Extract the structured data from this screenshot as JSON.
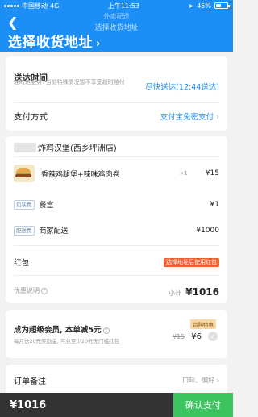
{
  "status_bar": {
    "carrier": "中国移动",
    "network": "4G",
    "time": "上午11:53",
    "battery": "45%",
    "battery_level": 0.45
  },
  "header": {
    "back_icon": "chevron-left-icon",
    "faded_tab": "外卖配送",
    "faded_title": "选择收货地址",
    "title": "选择收货地址",
    "title_arrow": "›"
  },
  "delivery_card": {
    "delivery_label": "送达时间",
    "delivery_note": "准时达服务: 当前特殊情况暂不享受超时赔付",
    "delivery_value": "尽快送达(12:44送达)",
    "payment_label": "支付方式",
    "payment_value": "支付宝免密支付",
    "arrow": "›"
  },
  "order_card": {
    "shop_name": "炸鸡汉堡(西乡坪洲店)",
    "item": {
      "name": "香辣鸡腿堡+辣味鸡肉卷",
      "qty": "×1",
      "price": "¥15"
    },
    "packing": {
      "tag": "包装费",
      "label": "餐盒",
      "price": "¥1"
    },
    "delivery": {
      "tag": "配送费",
      "label": "商家配送",
      "price": "¥1000"
    },
    "redpack_label": "红包",
    "redpack_value": "选择地址后使用红包",
    "discount_label": "优惠说明",
    "subtotal_label": "小计",
    "subtotal_value": "¥1016"
  },
  "member_card": {
    "title": "成为超级会员, 本单减5元",
    "desc": "每月送20元奖励金, 可兑至少20元无门槛红包",
    "badge": "首购特惠",
    "old_price": "¥15",
    "new_price": "¥6"
  },
  "notes_card": {
    "label": "订单备注",
    "placeholder": "口味、偏好",
    "arrow": "›"
  },
  "bottom_bar": {
    "total": "¥1016",
    "confirm": "确认支付"
  },
  "colors": {
    "header_blue": "#1b8ff6",
    "confirm_green": "#3cc55f",
    "bottom_dark": "#333333",
    "redpack_orange": "#f0612e"
  }
}
